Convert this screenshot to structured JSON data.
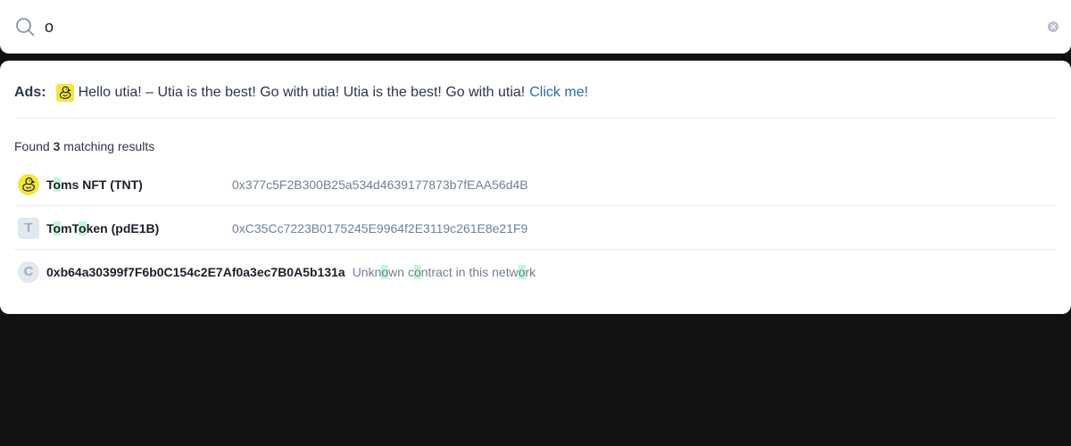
{
  "search": {
    "value": "o",
    "placeholder": ""
  },
  "ads": {
    "label": "Ads:",
    "text": "Hello utia! – Utia is the best! Go with utia! Utia is the best! Go with utia!",
    "link": "Click me!"
  },
  "results": {
    "found_prefix": "Found ",
    "count": "3",
    "found_suffix": " matching results",
    "items": [
      {
        "name_parts": [
          "T",
          "o",
          "ms NFT (TNT)"
        ],
        "address": "0x377c5F2B300B25a534d4639177873b7fEAA56d4B",
        "avatar": "duck-icon"
      },
      {
        "name_parts": [
          "T",
          "o",
          "mT",
          "o",
          "ken (pdE1B)"
        ],
        "address": "0xC35Cc7223B0175245E9964f2E3119c261E8e21F9",
        "avatar": "T"
      },
      {
        "name": "0xb64a30399f7F6b0C154c2E7Af0a3ec7B0A5b131a",
        "desc_parts": [
          "Unkn",
          "o",
          "wn c",
          "o",
          "ntract in this netw",
          "o",
          "rk"
        ],
        "avatar": "C"
      }
    ]
  },
  "colors": {
    "link": "#2b6cb0",
    "highlight": "#c6f6d5",
    "backdrop": "#101112",
    "duck_bg": "#f5e63a"
  }
}
